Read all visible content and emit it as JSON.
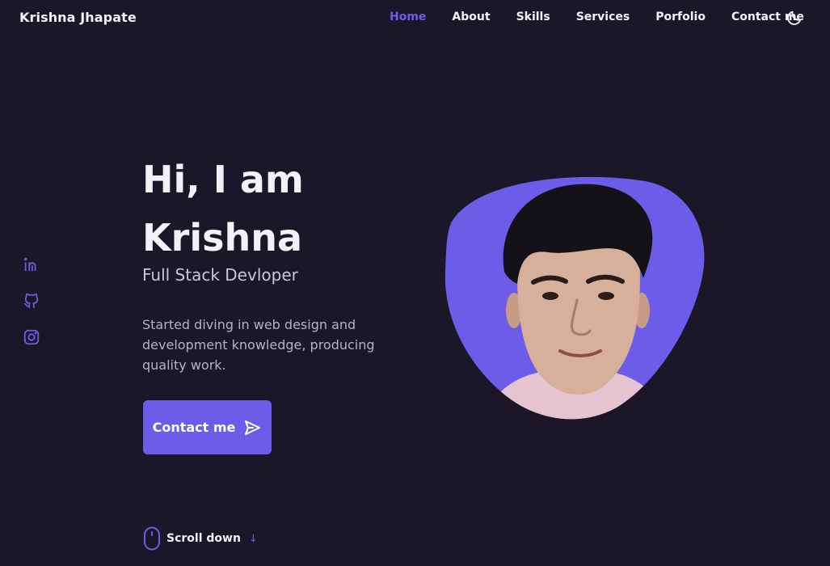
{
  "header": {
    "logo": "Krishna Jhapate",
    "nav": [
      {
        "label": "Home",
        "active": true
      },
      {
        "label": "About",
        "active": false
      },
      {
        "label": "Skills",
        "active": false
      },
      {
        "label": "Services",
        "active": false
      },
      {
        "label": "Porfolio",
        "active": false
      },
      {
        "label": "Contact me",
        "active": false
      }
    ],
    "theme_icon": "moon-icon"
  },
  "social": [
    {
      "icon": "linkedin-icon"
    },
    {
      "icon": "github-icon"
    },
    {
      "icon": "instagram-icon"
    }
  ],
  "hero": {
    "greeting": "Hi, I am",
    "name": "Krishna",
    "subtitle": "Full Stack Devloper",
    "description": "Started diving in web design and development knowledge, producing quality work.",
    "button_label": "Contact me",
    "button_icon": "send-icon",
    "avatar": "profile-photo"
  },
  "scroll": {
    "label": "Scroll down",
    "icon": "mouse-icon",
    "arrow": "↓"
  },
  "colors": {
    "background": "#1b1728",
    "accent": "#6c5ce7",
    "text": "#f2f1f7",
    "muted": "#b6b2c5"
  }
}
